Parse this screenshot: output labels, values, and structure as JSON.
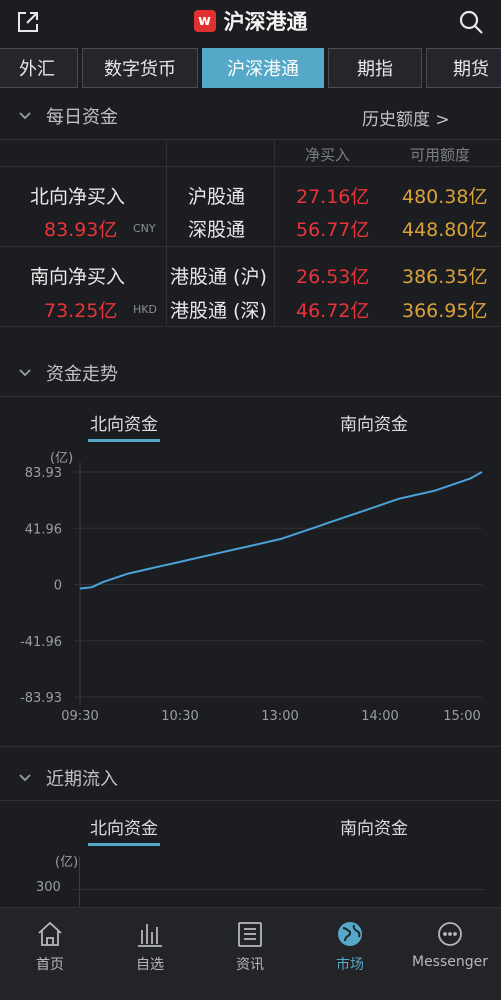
{
  "header": {
    "title": "沪深港通",
    "logo_letter": "w",
    "left_icon": "external-link-icon",
    "right_icon": "search-icon"
  },
  "tabs": [
    {
      "label": "外汇"
    },
    {
      "label": "数字货币"
    },
    {
      "label": "沪深港通",
      "active": true
    },
    {
      "label": "期指"
    },
    {
      "label": "期货"
    }
  ],
  "daily": {
    "title": "每日资金",
    "history_link": "历史额度 >",
    "col_net": "净买入",
    "col_avail": "可用额度",
    "north": {
      "label": "北向净买入",
      "total": "83.93亿",
      "currency": "CNY",
      "rows": [
        {
          "name": "沪股通",
          "net": "27.16亿",
          "avail": "480.38亿"
        },
        {
          "name": "深股通",
          "net": "56.77亿",
          "avail": "448.80亿"
        }
      ]
    },
    "south": {
      "label": "南向净买入",
      "total": "73.25亿",
      "currency": "HKD",
      "rows": [
        {
          "name": "港股通 (沪)",
          "net": "26.53亿",
          "avail": "386.35亿"
        },
        {
          "name": "港股通 (深)",
          "net": "46.72亿",
          "avail": "366.95亿"
        }
      ]
    }
  },
  "trend": {
    "title": "资金走势",
    "tab_north": "北向资金",
    "tab_south": "南向资金",
    "unit": "(亿)"
  },
  "recent": {
    "title": "近期流入",
    "tab_north": "北向资金",
    "tab_south": "南向资金",
    "unit": "(亿)",
    "first_tick": "300"
  },
  "chart_data": {
    "type": "line",
    "ylim": [
      -83.93,
      83.93
    ],
    "yticks": [
      "83.93",
      "41.96",
      "0",
      "-41.96",
      "-83.93"
    ],
    "xticks": [
      "09:30",
      "10:30",
      "13:00",
      "14:00",
      "15:00"
    ],
    "color": "#4aa3d8",
    "series": [
      {
        "values": [
          -3,
          -2,
          2,
          5,
          8,
          10,
          12,
          14,
          16,
          18,
          20,
          22,
          24,
          26,
          28,
          30,
          32,
          34,
          37,
          40,
          43,
          46,
          49,
          52,
          55,
          58,
          61,
          64,
          66,
          68,
          70,
          73,
          76,
          79,
          83.93
        ]
      }
    ]
  },
  "nav": [
    {
      "label": "首页",
      "icon": "home-icon"
    },
    {
      "label": "自选",
      "icon": "bar-chart-icon"
    },
    {
      "label": "资讯",
      "icon": "news-icon"
    },
    {
      "label": "市场",
      "icon": "globe-icon",
      "active": true
    },
    {
      "label": "Messenger",
      "icon": "chat-icon"
    }
  ]
}
